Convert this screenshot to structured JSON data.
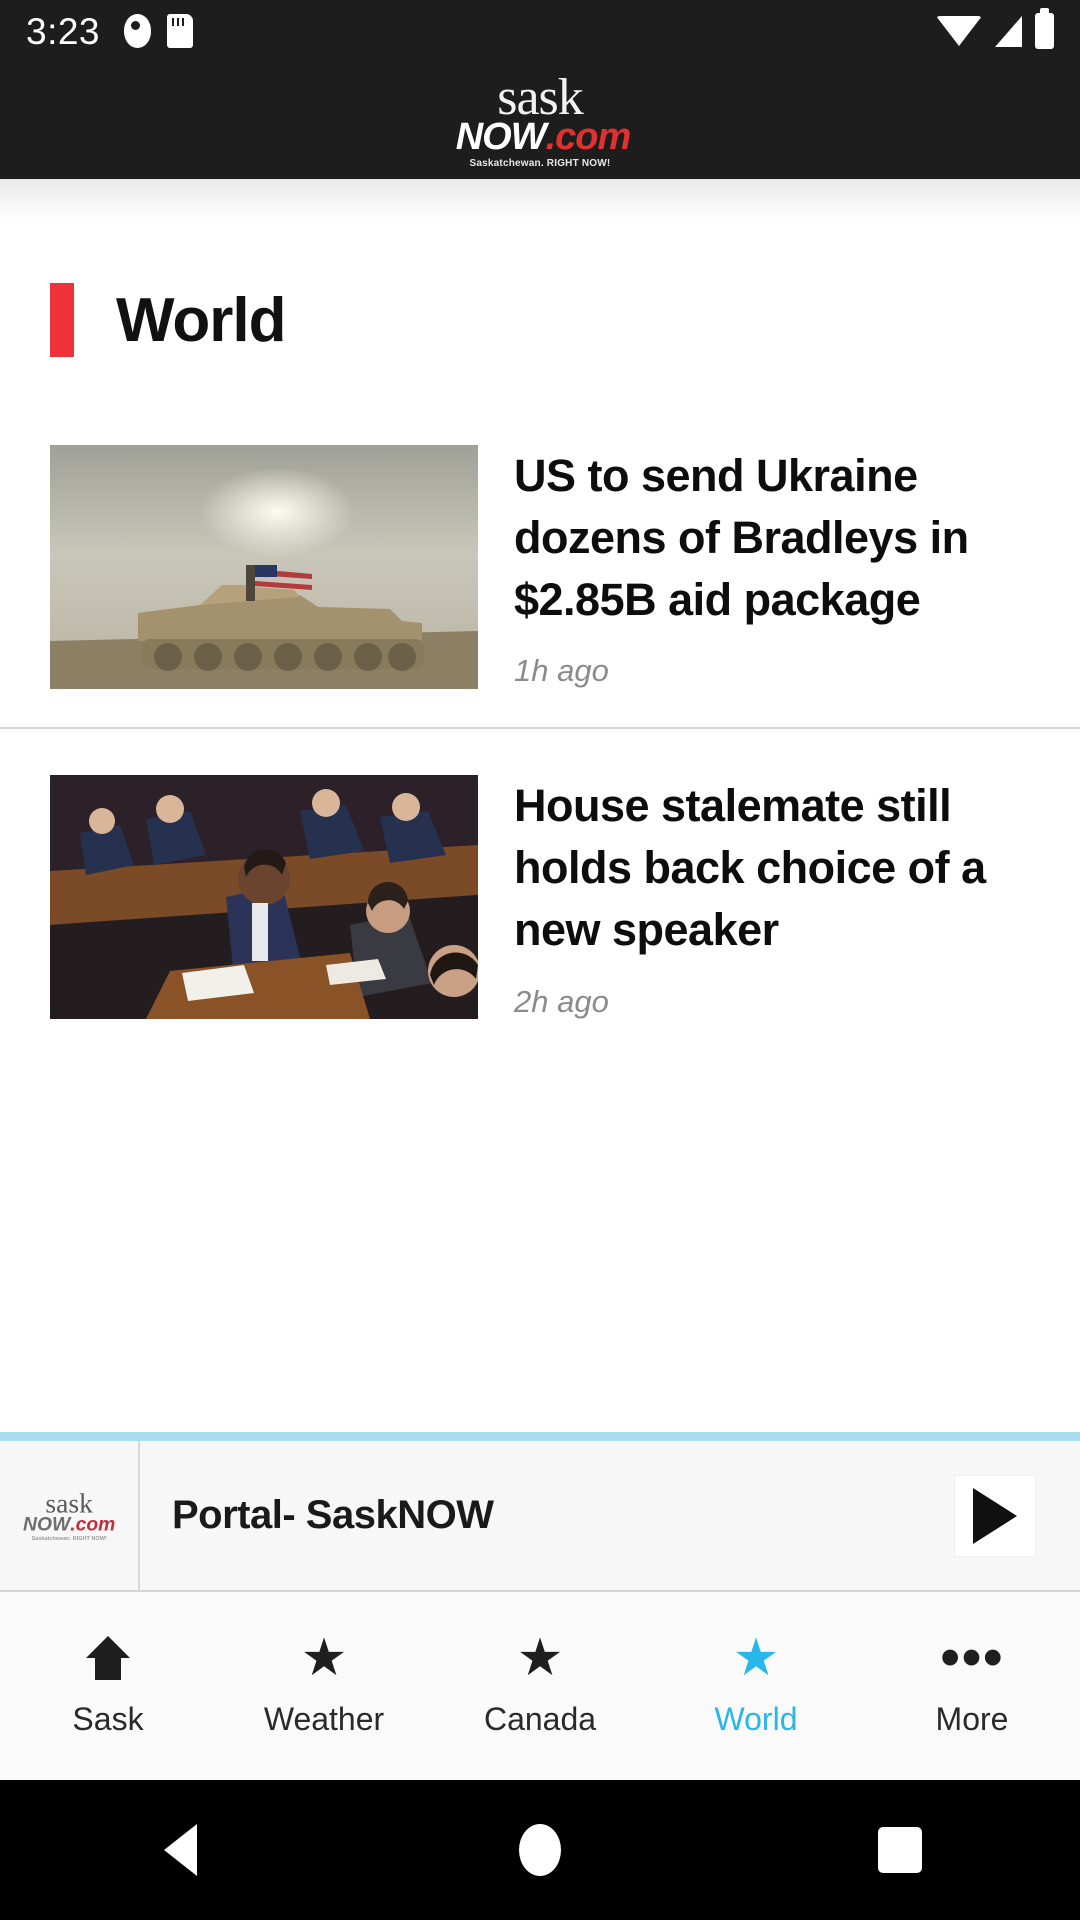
{
  "status_bar": {
    "time": "3:23",
    "icons_left": [
      "notification-icon",
      "sd-card-icon"
    ],
    "icons_right": [
      "wifi-icon",
      "cellular-signal-icon",
      "battery-icon"
    ]
  },
  "header": {
    "logo_primary": "sask",
    "logo_secondary": "NOW",
    "logo_domain": ".com",
    "logo_tagline": "Saskatchewan. RIGHT NOW!"
  },
  "section": {
    "title": "World",
    "accent_color": "#ee3338"
  },
  "articles": [
    {
      "title": "US to send Ukraine dozens of Bradleys in $2.85B aid package",
      "time": "1h ago",
      "image_alt": "military-vehicle-with-us-flag"
    },
    {
      "title": "House stalemate still holds back choice of a new speaker",
      "time": "2h ago",
      "image_alt": "congress-chamber-speaker"
    }
  ],
  "player": {
    "title": "Portal- SaskNOW",
    "play_icon": "play-icon",
    "accent_color": "#aadcef",
    "thumb_primary": "sask",
    "thumb_secondary": "NOW",
    "thumb_domain": ".com",
    "thumb_tagline": "Saskatchewan. RIGHT NOW!"
  },
  "bottom_nav": {
    "active_color": "#29b6e8",
    "items": [
      {
        "label": "Sask",
        "icon": "home-icon",
        "active": false
      },
      {
        "label": "Weather",
        "icon": "star-icon",
        "active": false
      },
      {
        "label": "Canada",
        "icon": "star-icon",
        "active": false
      },
      {
        "label": "World",
        "icon": "star-icon",
        "active": true
      },
      {
        "label": "More",
        "icon": "ellipsis-icon",
        "active": false
      }
    ]
  },
  "android_nav": {
    "back": "back-triangle-icon",
    "home": "home-circle-icon",
    "recents": "recents-square-icon"
  }
}
